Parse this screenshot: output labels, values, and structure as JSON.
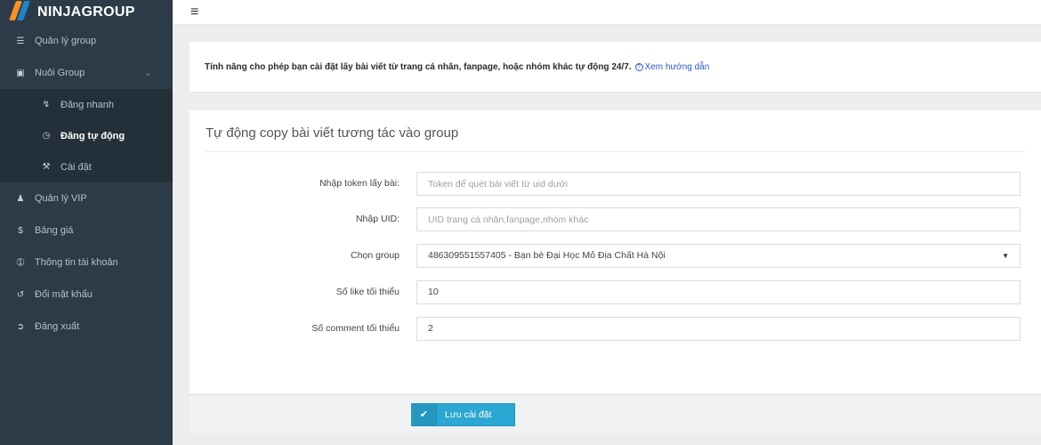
{
  "brand": {
    "name": "NINJAGROUP"
  },
  "sidebar": {
    "items": [
      {
        "icon": "database-icon",
        "label": "Quản lý group"
      },
      {
        "icon": "calendar-check-icon",
        "label": "Nuôi Group"
      },
      {
        "icon": "user-plus-icon",
        "label": "Quản lý VIP"
      },
      {
        "icon": "dollar-icon",
        "label": "Bảng giá"
      },
      {
        "icon": "info-icon",
        "label": "Thông tin tài khoản"
      },
      {
        "icon": "refresh-icon",
        "label": "Đổi mật khẩu"
      },
      {
        "icon": "sign-out-icon",
        "label": "Đăng xuất"
      }
    ],
    "submenu": [
      {
        "icon": "bolt-icon",
        "label": "Đăng nhanh"
      },
      {
        "icon": "clock-icon",
        "label": "Đăng tự động"
      },
      {
        "icon": "wrench-icon",
        "label": "Cài đặt"
      }
    ]
  },
  "notice": {
    "text": "Tính năng cho phép bạn cài đặt lấy bài viết từ trang cá nhân, fanpage, hoặc nhóm khác tự động 24/7.",
    "help_icon": "?",
    "help_link": "Xem hướng dẫn"
  },
  "form": {
    "title": "Tự động copy bài viết tương tác vào group",
    "token_label": "Nhập token lấy bài:",
    "token_placeholder": "Token để quét bài viết từ uid dưới",
    "token_value": "",
    "uid_label": "Nhập UID:",
    "uid_placeholder": "UID trang cá nhân,fanpage,nhóm khác",
    "uid_value": "",
    "group_label": "Chọn group",
    "group_selected": "486309551557405 - Bạn bè Đại Học Mỏ Địa Chất Hà Nội",
    "likes_label": "Số like tối thiểu",
    "likes_value": "10",
    "comments_label": "Số comment tối thiểu",
    "comments_value": "2"
  },
  "footer": {
    "save_label": "Lưu cài đặt"
  },
  "colors": {
    "sidebar_bg": "#2c3b47",
    "accent": "#2aa7d2",
    "link": "#2a58ce"
  }
}
